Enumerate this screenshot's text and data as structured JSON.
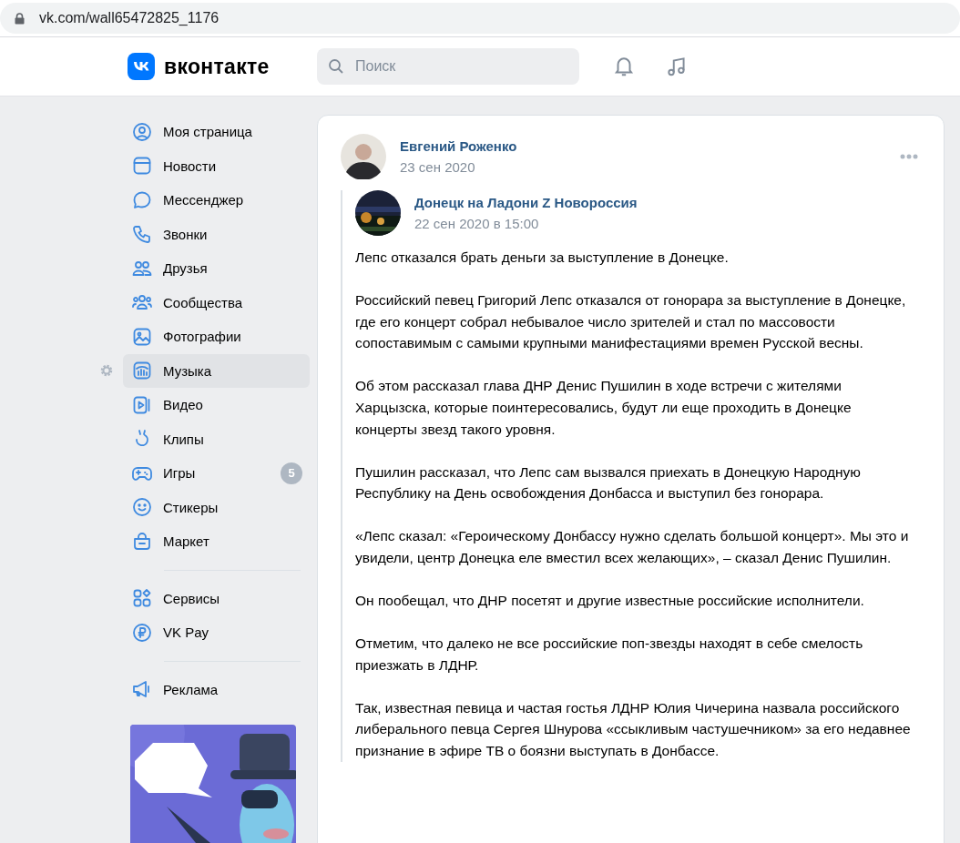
{
  "browser": {
    "url": "vk.com/wall65472825_1176"
  },
  "header": {
    "logo_text": "вконтакте",
    "search": {
      "placeholder": "Поиск"
    }
  },
  "sidebar": {
    "sections": [
      {
        "items": [
          {
            "label": "Моя страница",
            "selected": false
          },
          {
            "label": "Новости",
            "selected": false
          },
          {
            "label": "Мессенджер",
            "selected": false
          },
          {
            "label": "Звонки",
            "selected": false
          },
          {
            "label": "Друзья",
            "selected": false
          },
          {
            "label": "Сообщества",
            "selected": false
          },
          {
            "label": "Фотографии",
            "selected": false
          },
          {
            "label": "Музыка",
            "selected": true
          },
          {
            "label": "Видео",
            "selected": false
          },
          {
            "label": "Клипы",
            "selected": false
          },
          {
            "label": "Игры",
            "selected": false,
            "badge": "5"
          },
          {
            "label": "Стикеры",
            "selected": false
          },
          {
            "label": "Маркет",
            "selected": false
          }
        ]
      },
      {
        "items": [
          {
            "label": "Сервисы",
            "selected": false
          },
          {
            "label": "VK Pay",
            "selected": false
          }
        ]
      },
      {
        "items": [
          {
            "label": "Реклама",
            "selected": false
          }
        ]
      }
    ]
  },
  "post": {
    "author": "Евгений Роженко",
    "date": "23 сен 2020",
    "repost": {
      "author": "Донецк на Ладони Z Новороссия",
      "date": "22 сен 2020 в 15:00",
      "paragraphs": [
        "Лепс отказался брать деньги за выступление в Донецке.",
        "Российский певец Григорий Лепс отказался от гонорара за выступление в Донецке, где его концерт собрал небывалое число зрителей и стал по массовости сопоставимым с самыми крупными манифестациями времен Русской весны.",
        "Об этом рассказал глава ДНР Денис Пушилин в ходе встречи с жителями Харцызска, которые поинтересовались, будут ли еще проходить в Донецке концерты звезд такого уровня.",
        "Пушилин рассказал, что Лепс сам вызвался приехать в Донецкую Народную Республику на День освобождения Донбасса и выступил без гонорара.",
        "«Лепс сказал: «Героическому Донбассу нужно сделать большой концерт». Мы это и увидели, центр Донецка еле вместил всех желающих», – сказал Денис Пушилин.",
        "Он пообещал, что ДНР посетят и другие известные российские исполнители.",
        "Отметим, что далеко не все российские поп-звезды находят в себе смелость приезжать в ЛДНР.",
        "Так, известная певица и частая гостья ЛДНР Юлия Чичерина назвала российского либерального певца Сергея Шнурова «ссыкливым частушечником» за его недавнее признание в эфире ТВ о боязни выступать в Донбассе."
      ]
    }
  }
}
